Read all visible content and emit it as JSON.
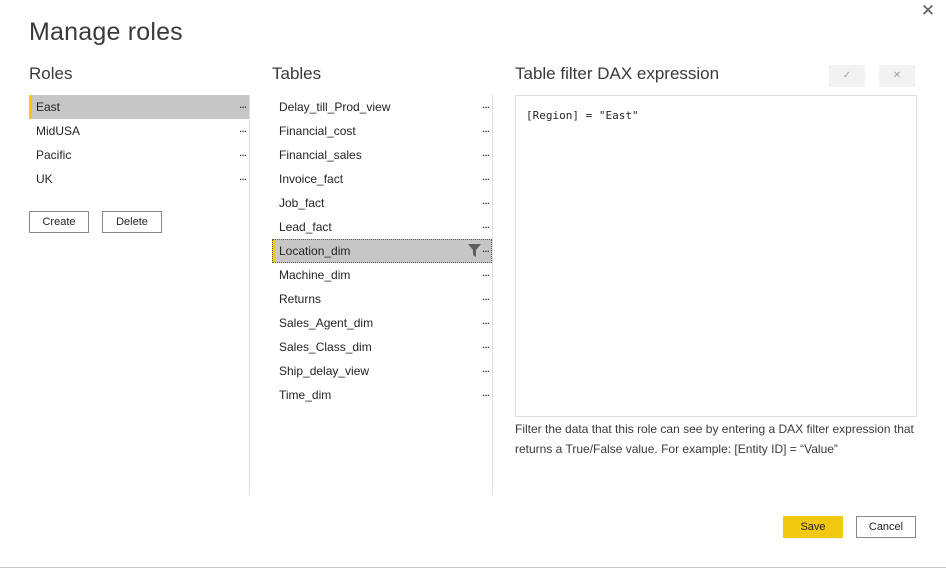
{
  "dialog": {
    "title": "Manage roles",
    "close_glyph": "✕"
  },
  "roles": {
    "header": "Roles",
    "items": [
      {
        "label": "East",
        "selected": true
      },
      {
        "label": "MidUSA",
        "selected": false
      },
      {
        "label": "Pacific",
        "selected": false
      },
      {
        "label": "UK",
        "selected": false
      }
    ],
    "more_glyph": "...",
    "create_label": "Create",
    "delete_label": "Delete"
  },
  "tables": {
    "header": "Tables",
    "items": [
      {
        "label": "Delay_till_Prod_view",
        "selected": false,
        "filtered": false
      },
      {
        "label": "Financial_cost",
        "selected": false,
        "filtered": false
      },
      {
        "label": "Financial_sales",
        "selected": false,
        "filtered": false
      },
      {
        "label": "Invoice_fact",
        "selected": false,
        "filtered": false
      },
      {
        "label": "Job_fact",
        "selected": false,
        "filtered": false
      },
      {
        "label": "Lead_fact",
        "selected": false,
        "filtered": false
      },
      {
        "label": "Location_dim",
        "selected": true,
        "filtered": true
      },
      {
        "label": "Machine_dim",
        "selected": false,
        "filtered": false
      },
      {
        "label": "Returns",
        "selected": false,
        "filtered": false
      },
      {
        "label": "Sales_Agent_dim",
        "selected": false,
        "filtered": false
      },
      {
        "label": "Sales_Class_dim",
        "selected": false,
        "filtered": false
      },
      {
        "label": "Ship_delay_view",
        "selected": false,
        "filtered": false
      },
      {
        "label": "Time_dim",
        "selected": false,
        "filtered": false
      }
    ],
    "more_glyph": "..."
  },
  "dax": {
    "header": "Table filter DAX expression",
    "confirm_glyph": "✓",
    "cancel_glyph": "✕",
    "expression": "[Region] = \"East\"",
    "help_text": "Filter the data that this role can see by entering a DAX filter expression that returns a True/False value. For example: [Entity ID] = “Value”"
  },
  "footer": {
    "save_label": "Save",
    "cancel_label": "Cancel"
  },
  "colors": {
    "accent": "#f2c811",
    "selected_bg": "#c8c6c4",
    "border": "#8a8886",
    "divider": "#e1dfdd"
  }
}
